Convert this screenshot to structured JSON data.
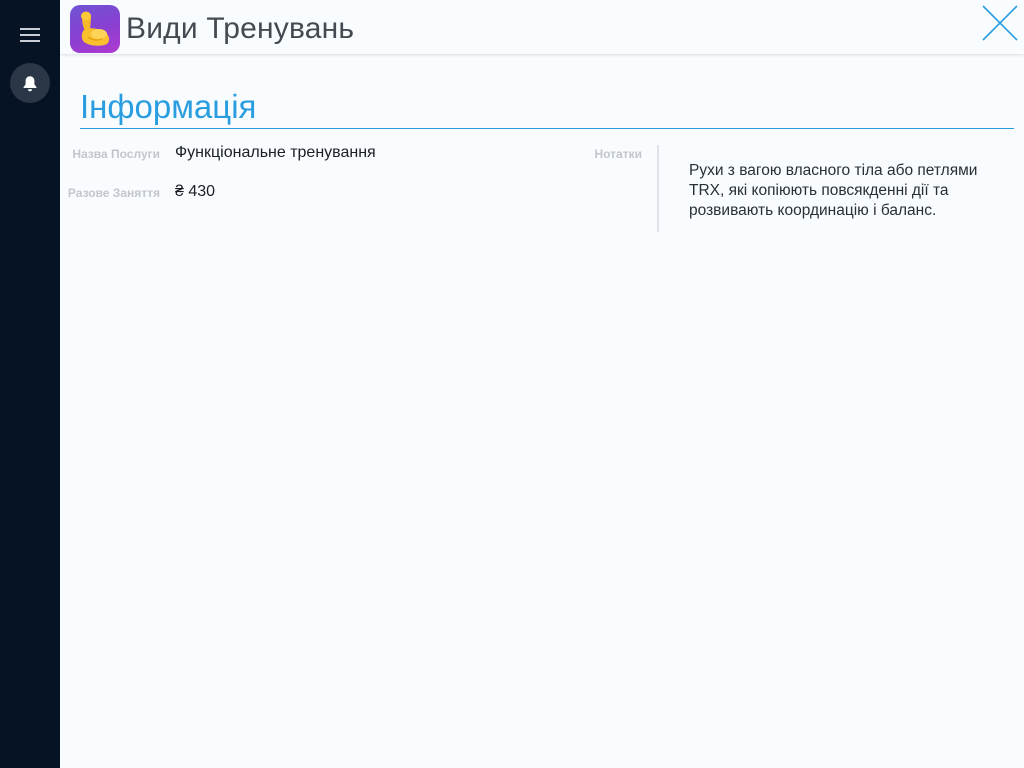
{
  "header": {
    "title": "Види Тренувань",
    "app_icon": "flexed-biceps-icon"
  },
  "sidebar": {
    "menu_icon": "hamburger-menu-icon",
    "notifications_icon": "bell-icon"
  },
  "section": {
    "title": "Інформація"
  },
  "fields": {
    "service_name": {
      "label": "Назва Послуги",
      "value": "Функціональне тренування"
    },
    "single_session": {
      "label": "Разове Заняття",
      "value": "₴ 430"
    },
    "notes": {
      "label": "Нотатки",
      "value": "Рухи з вагою власного тіла або петлями TRX, які копіюють повсякденні дії та розвивають координацію і баланс."
    }
  },
  "colors": {
    "sidebar_bg": "#061325",
    "accent": "#2a9de0",
    "app_icon_gradient_start": "#6e55d4",
    "app_icon_gradient_end": "#b13ad0"
  }
}
